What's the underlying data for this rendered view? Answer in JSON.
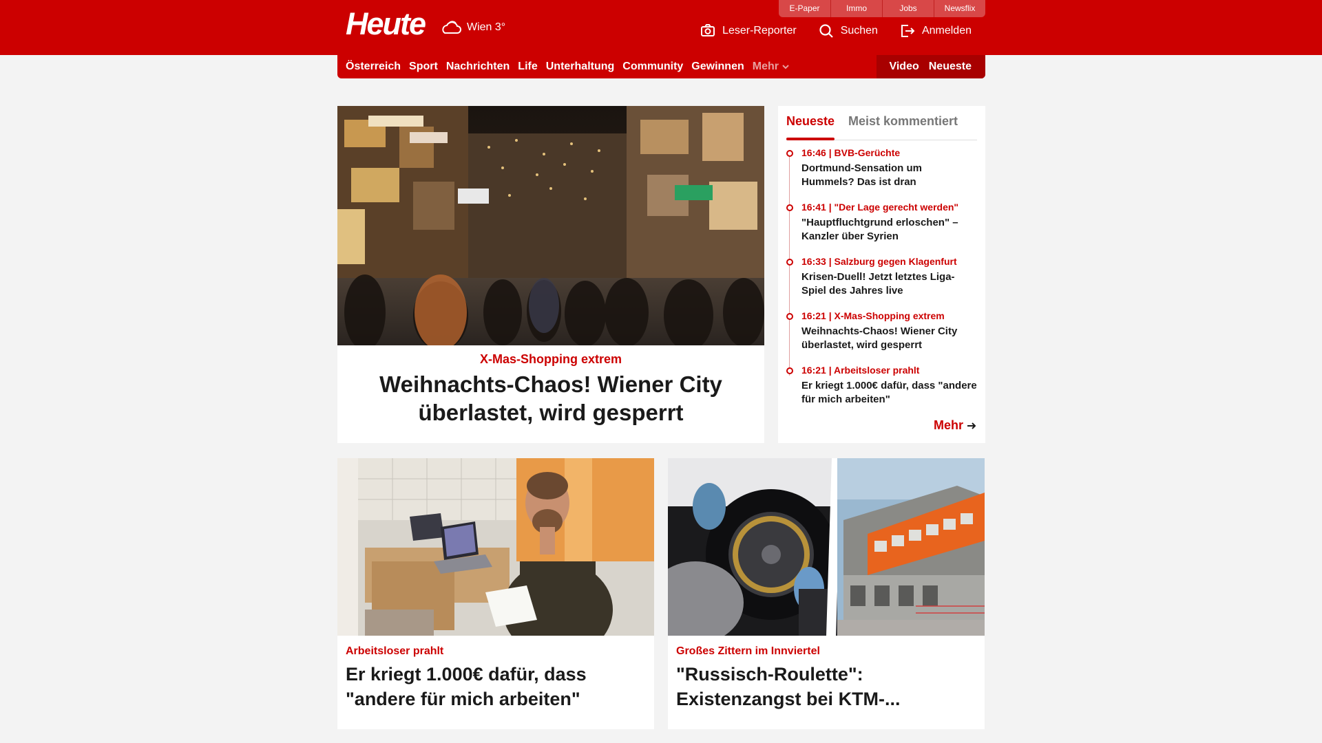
{
  "header": {
    "logo": "Heute",
    "weather_icon": "cloud-sun-icon",
    "weather_text": "Wien 3°",
    "top_links": [
      "E-Paper",
      "Immo",
      "Jobs",
      "Newsflix"
    ],
    "actions": [
      {
        "label": "Leser-Reporter",
        "icon": "camera-icon"
      },
      {
        "label": "Suchen",
        "icon": "search-icon"
      },
      {
        "label": "Anmelden",
        "icon": "login-icon"
      }
    ]
  },
  "nav": {
    "items": [
      "Österreich",
      "Sport",
      "Nachrichten",
      "Life",
      "Unterhaltung",
      "Community",
      "Gewinnen"
    ],
    "more_label": "Mehr",
    "right_items": [
      "Video",
      "Neueste"
    ]
  },
  "hero": {
    "kicker": "X-Mas-Shopping extrem",
    "title": "Weihnachts-Chaos! Wiener City überlastet, wird gesperrt",
    "image_desc": "crowded shopping street with christmas lights"
  },
  "sidebar": {
    "tabs": [
      "Neueste",
      "Meist kommentiert"
    ],
    "active_tab": "Neueste",
    "items": [
      {
        "meta": "16:46 | BVB-Gerüchte",
        "title": "Dortmund-Sensation um Hummels? Das ist dran"
      },
      {
        "meta": "16:41 | \"Der Lage gerecht werden\"",
        "title": "\"Hauptfluchtgrund erloschen\" – Kanzler über Syrien"
      },
      {
        "meta": "16:33 | Salzburg gegen Klagenfurt",
        "title": "Krisen-Duell! Jetzt letztes Liga-Spiel des Jahres live"
      },
      {
        "meta": "16:21 | X-Mas-Shopping extrem",
        "title": "Weihnachts-Chaos! Wiener City überlastet, wird gesperrt"
      },
      {
        "meta": "16:21 | Arbeitsloser prahlt",
        "title": "Er kriegt 1.000€ dafür, dass \"andere für mich arbeiten\""
      }
    ],
    "more_label": "Mehr"
  },
  "cards": [
    {
      "kicker": "Arbeitsloser prahlt",
      "title": "Er kriegt 1.000€ dafür, dass \"andere für mich arbeiten\""
    },
    {
      "kicker": "Großes Zittern im Innviertel",
      "title": "\"Russisch-Roulette\": Existenzangst bei KTM-..."
    }
  ],
  "colors": {
    "brand_red": "#cc0000",
    "dark_red": "#a80000",
    "page_bg": "#f3f3f3"
  }
}
